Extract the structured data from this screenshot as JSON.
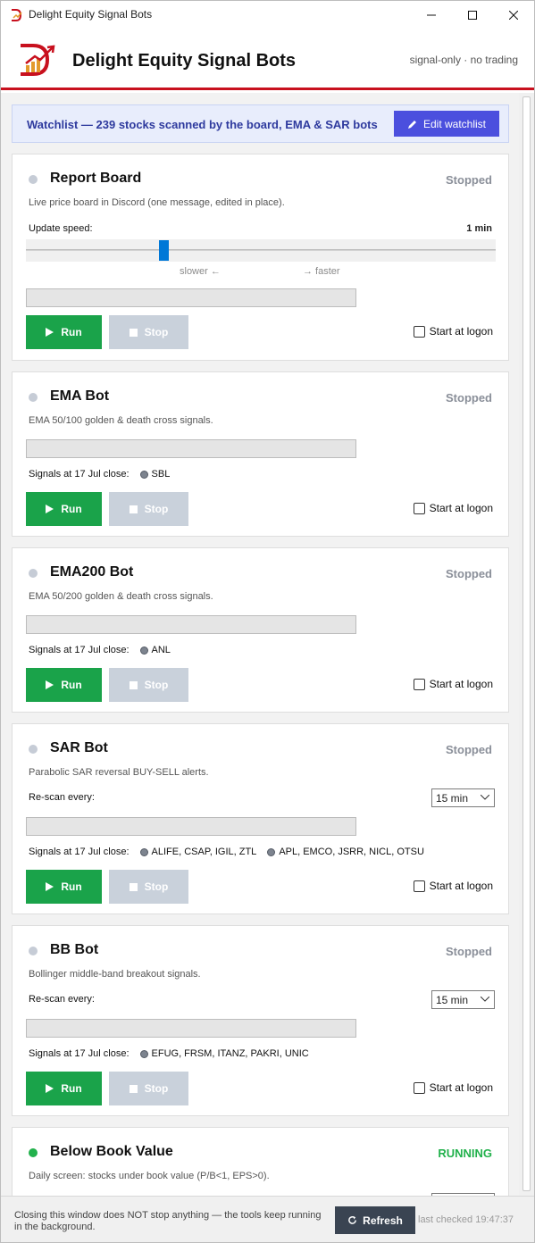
{
  "window": {
    "title": "Delight Equity Signal Bots"
  },
  "header": {
    "title": "Delight Equity Signal Bots",
    "tagline": "signal-only · no trading"
  },
  "watchlist": {
    "text": "Watchlist — 239 stocks scanned by the board, EMA & SAR bots",
    "button": "Edit watchlist"
  },
  "common": {
    "run": "Run",
    "stop": "Stop",
    "start_at_logon": "Start at logon",
    "rescan": "Re-scan every:",
    "signals_label": "Signals at 17 Jul close:"
  },
  "cards": {
    "report": {
      "name": "Report Board",
      "status": "Stopped",
      "desc": "Live price board in Discord (one message, edited in place).",
      "speed_label": "Update speed:",
      "speed_value": "1 min",
      "slower": "slower ←",
      "faster": "→ faster",
      "slider_level": 0.29
    },
    "ema": {
      "name": "EMA Bot",
      "status": "Stopped",
      "desc": "EMA 50/100 golden & death cross signals.",
      "signals": [
        "SBL"
      ]
    },
    "ema200": {
      "name": "EMA200 Bot",
      "status": "Stopped",
      "desc": "EMA 50/200 golden & death cross signals.",
      "signals": [
        "ANL"
      ]
    },
    "sar": {
      "name": "SAR Bot",
      "status": "Stopped",
      "desc": "Parabolic SAR reversal BUY-SELL alerts.",
      "interval": "15 min",
      "signals": [
        "ALIFE, CSAP, IGIL, ZTL",
        "APL, EMCO, JSRR, NICL, OTSU"
      ]
    },
    "bb": {
      "name": "BB Bot",
      "status": "Stopped",
      "desc": "Bollinger middle-band breakout signals.",
      "interval": "15 min",
      "signals": [
        "EFUG, FRSM, ITANZ, PAKRI, UNIC"
      ]
    },
    "book": {
      "name": "Below Book Value",
      "status": "RUNNING",
      "desc": "Daily screen: stocks under book value (P/B<1, EPS>0)."
    }
  },
  "footer": {
    "note": "Closing this window does NOT stop anything — the tools keep running in the background.",
    "refresh": "Refresh",
    "last_checked": "last checked 19:47:37"
  },
  "colors": {
    "accent": "#c8101e",
    "run": "#1aa34a",
    "indigo": "#4b4fde",
    "running": "#22b14c"
  }
}
